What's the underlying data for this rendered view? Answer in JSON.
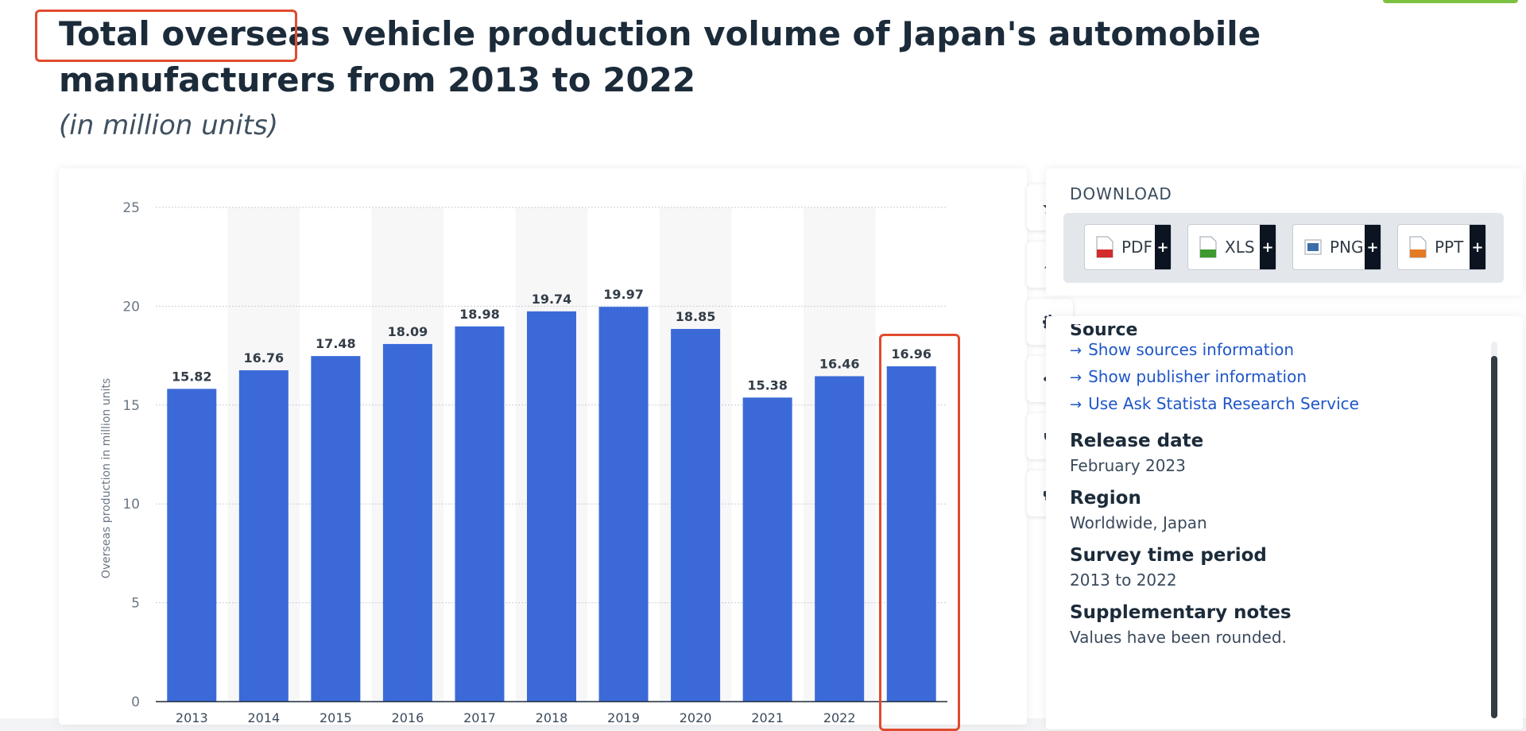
{
  "title": {
    "main": "Total overseas vehicle production volume of Japan's automobile manufacturers from 2013 to 2022",
    "subtitle": "(in million units)"
  },
  "chart_data": {
    "type": "bar",
    "categories": [
      "2013",
      "2014",
      "2015",
      "2016",
      "2017",
      "2018",
      "2019",
      "2020",
      "2021",
      "2022"
    ],
    "values": [
      15.82,
      16.76,
      17.48,
      18.09,
      18.98,
      19.74,
      19.97,
      18.85,
      15.38,
      16.46,
      16.96
    ],
    "value_labels": [
      "15.82",
      "16.76",
      "17.48",
      "18.09",
      "18.98",
      "19.74",
      "19.97",
      "18.85",
      "15.38",
      "16.46",
      "16.96"
    ],
    "ylabel": "Overseas production in million units",
    "ylim": [
      0,
      25
    ],
    "yticks": [
      0,
      5,
      10,
      15,
      20,
      25
    ],
    "ytick_labels": [
      "0",
      "5",
      "10",
      "15",
      "20",
      "25"
    ],
    "grid": true,
    "bar_color": "#3b6ad8"
  },
  "toolbar": {
    "buttons": [
      "star-icon",
      "bell-icon",
      "gear-icon",
      "share-icon",
      "quote-icon",
      "print-icon"
    ]
  },
  "download": {
    "label": "DOWNLOAD",
    "buttons": [
      {
        "label": "PDF",
        "plus": "+",
        "icon": "pdf-file-icon",
        "color": "#d42b2b"
      },
      {
        "label": "XLS",
        "plus": "+",
        "icon": "xls-file-icon",
        "color": "#3d9a2f"
      },
      {
        "label": "PNG",
        "plus": "+",
        "icon": "png-file-icon",
        "color": "#3a6ea8"
      },
      {
        "label": "PPT",
        "plus": "+",
        "icon": "ppt-file-icon",
        "color": "#e57a25"
      }
    ]
  },
  "details": {
    "source_heading": "Source",
    "links": [
      "Show sources information",
      "Show publisher information",
      "Use Ask Statista Research Service"
    ],
    "release_date_label": "Release date",
    "release_date": "February 2023",
    "region_label": "Region",
    "region": "Worldwide, Japan",
    "survey_label": "Survey time period",
    "survey": "2013 to 2022",
    "notes_label": "Supplementary notes",
    "notes": "Values have been rounded."
  }
}
